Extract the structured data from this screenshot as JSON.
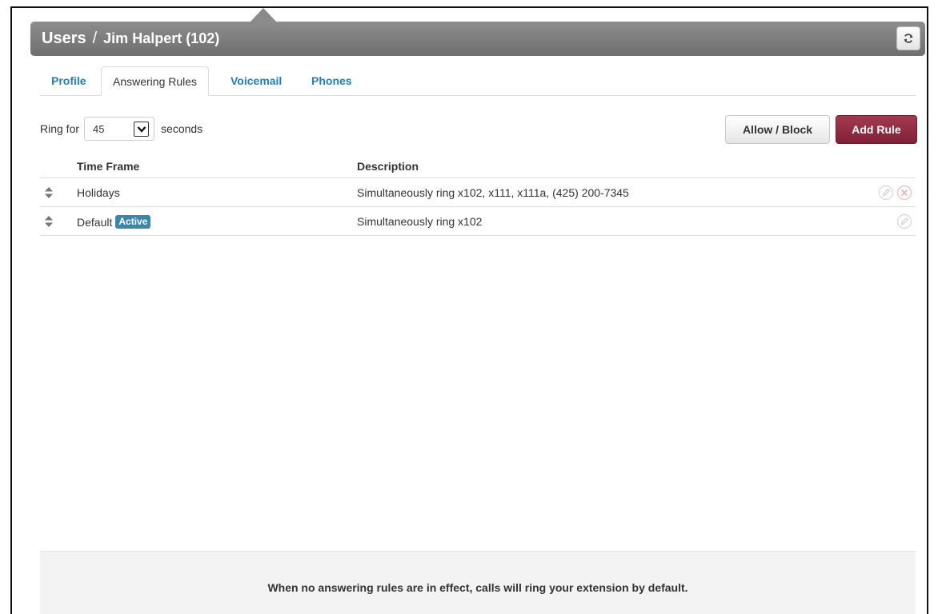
{
  "header": {
    "section": "Users",
    "separator": "/",
    "user": "Jim Halpert (102)"
  },
  "tabs": [
    {
      "label": "Profile",
      "active": false
    },
    {
      "label": "Answering Rules",
      "active": true
    },
    {
      "label": "Voicemail",
      "active": false
    },
    {
      "label": "Phones",
      "active": false
    }
  ],
  "ring": {
    "prefix": "Ring for",
    "value": "45",
    "suffix": "seconds"
  },
  "buttons": {
    "allow_block": "Allow / Block",
    "add_rule": "Add Rule"
  },
  "table": {
    "headers": {
      "time_frame": "Time Frame",
      "description": "Description"
    },
    "rows": [
      {
        "time_frame": "Holidays",
        "description": "Simultaneously ring x102, x111, x111a, (425) 200-7345",
        "badge": ""
      },
      {
        "time_frame": "Default",
        "description": "Simultaneously ring x102",
        "badge": "Active"
      }
    ]
  },
  "footer": {
    "note": "When no answering rules are in effect, calls will ring your extension by default."
  },
  "colors": {
    "link_blue": "#1a81c2",
    "add_rule_bg": "#8b2a40",
    "active_badge": "#3a87ad",
    "titlebar_gray": "#7d7d7d"
  },
  "icons": [
    "refresh-icon",
    "sort-arrows-icon",
    "edit-icon",
    "delete-icon",
    "chevron-down-icon"
  ]
}
